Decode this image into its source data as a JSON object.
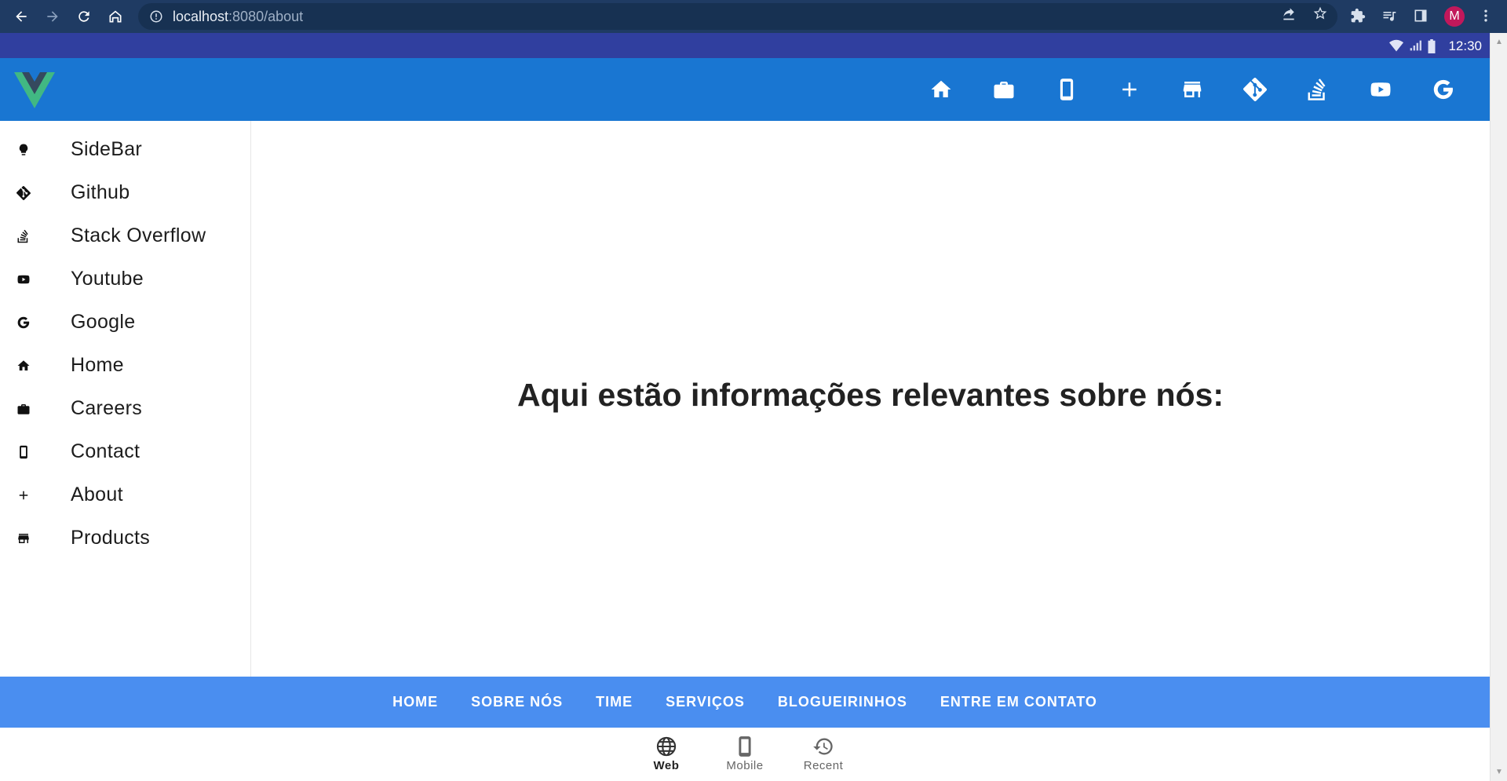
{
  "browser": {
    "url_host": "localhost",
    "url_rest": ":8080/about",
    "avatar_letter": "M"
  },
  "statusbar": {
    "time": "12:30"
  },
  "appbar": {
    "icons": [
      "home-icon",
      "briefcase-icon",
      "phone-icon",
      "plus-icon",
      "store-icon",
      "git-icon",
      "stack-overflow-icon",
      "youtube-icon",
      "google-icon"
    ]
  },
  "sidebar": {
    "items": [
      {
        "label": "SideBar",
        "icon": "lightbulb-icon"
      },
      {
        "label": "Github",
        "icon": "git-icon"
      },
      {
        "label": "Stack Overflow",
        "icon": "stack-overflow-icon"
      },
      {
        "label": "Youtube",
        "icon": "youtube-icon"
      },
      {
        "label": "Google",
        "icon": "google-icon"
      },
      {
        "label": "Home",
        "icon": "home-icon"
      },
      {
        "label": "Careers",
        "icon": "briefcase-icon"
      },
      {
        "label": "Contact",
        "icon": "phone-icon"
      },
      {
        "label": "About",
        "icon": "plus-icon"
      },
      {
        "label": "Products",
        "icon": "store-icon"
      }
    ]
  },
  "main": {
    "title": "Aqui estão informações relevantes sobre nós:"
  },
  "footer": {
    "links": [
      "HOME",
      "SOBRE NÓS",
      "TIME",
      "SERVIÇOS",
      "BLOGUEIRINHOS",
      "ENTRE EM CONTATO"
    ]
  },
  "bottom_nav": {
    "items": [
      {
        "label": "Web",
        "icon": "globe-icon",
        "active": true
      },
      {
        "label": "Mobile",
        "icon": "phone-icon",
        "active": false
      },
      {
        "label": "Recent",
        "icon": "history-icon",
        "active": false
      }
    ]
  },
  "colors": {
    "appbar": "#1976d2",
    "statusbar": "#303f9f",
    "footer": "#4a8ef0",
    "chrome": "#1f3b63"
  }
}
